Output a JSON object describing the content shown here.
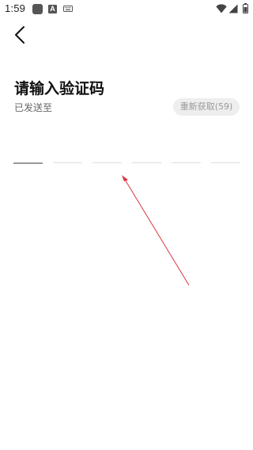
{
  "status_bar": {
    "time": "1:59",
    "icons": [
      "app-icon",
      "a-icon",
      "keyboard-icon",
      "wifi-icon",
      "signal-icon",
      "battery-icon"
    ],
    "a_glyph": "A"
  },
  "nav": {
    "back_icon": "chevron-left-icon"
  },
  "page": {
    "title": "请输入验证码",
    "sent_to_label": "已发送至",
    "resend_label": "重新获取(59)"
  },
  "otp": {
    "slot_count": 6,
    "active_index": 0
  },
  "colors": {
    "title": "#111111",
    "subtitle": "#666666",
    "resend_bg": "#eeeeee",
    "resend_text": "#999999",
    "slot_line": "#dddddd",
    "slot_active": "#999999",
    "annotation": "#d9363e"
  }
}
